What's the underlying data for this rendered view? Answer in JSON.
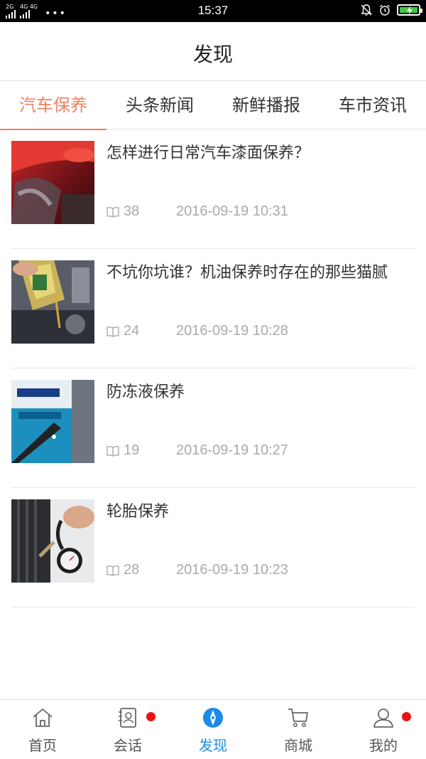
{
  "status_bar": {
    "signal1_label": "2G",
    "signal2_label": "4G 4G",
    "more": "•••",
    "time": "15:37"
  },
  "header": {
    "title": "发现"
  },
  "tabs": [
    {
      "label": "汽车保养",
      "active": true
    },
    {
      "label": "头条新闻",
      "active": false
    },
    {
      "label": "新鲜播报",
      "active": false
    },
    {
      "label": "车市资讯",
      "active": false
    }
  ],
  "articles": [
    {
      "title": "怎样进行日常汽车漆面保养？",
      "count": "38",
      "date": "2016-09-19 10:31",
      "thumb": "car-paint"
    },
    {
      "title": "不坑你坑谁？机油保养时存在的那些猫腻",
      "count": "24",
      "date": "2016-09-19 10:28",
      "thumb": "engine-oil"
    },
    {
      "title": "防冻液保养",
      "count": "19",
      "date": "2016-09-19 10:27",
      "thumb": "antifreeze"
    },
    {
      "title": "轮胎保养",
      "count": "28",
      "date": "2016-09-19 10:23",
      "thumb": "tire-gauge"
    }
  ],
  "bottom_nav": [
    {
      "label": "首页",
      "icon": "home-icon",
      "active": false,
      "badge": false
    },
    {
      "label": "会话",
      "icon": "contacts-icon",
      "active": false,
      "badge": true
    },
    {
      "label": "发现",
      "icon": "compass-icon",
      "active": true,
      "badge": false
    },
    {
      "label": "商城",
      "icon": "cart-icon",
      "active": false,
      "badge": false
    },
    {
      "label": "我的",
      "icon": "user-icon",
      "active": false,
      "badge": true
    }
  ],
  "colors": {
    "accent": "#f08060",
    "nav_active": "#1a8be8",
    "badge": "#ee1111",
    "battery": "#3cc83c"
  }
}
